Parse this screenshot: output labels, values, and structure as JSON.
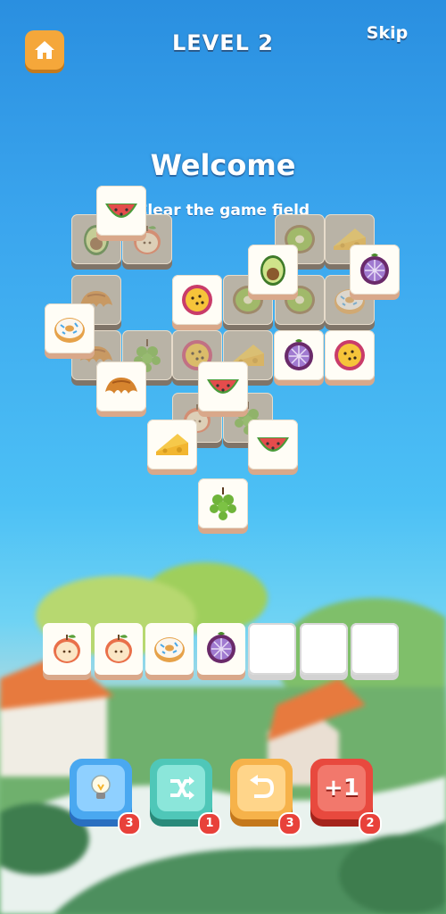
{
  "header": {
    "level_title": "LEVEL 2",
    "skip_label": "Skip",
    "home_icon": "home-icon"
  },
  "intro": {
    "title": "Welcome",
    "subtitle": "Clear the game field"
  },
  "colors": {
    "home_button": "#f5a73a",
    "hint_button": "#4aa8f0",
    "shuffle_button": "#4fc7b8",
    "undo_button": "#f6b24a",
    "extra_slot_button": "#e8493e",
    "badge": "#e8413a"
  },
  "board_tiles": [
    {
      "item": "kiwi",
      "state": "covered"
    },
    {
      "item": "cheese",
      "state": "covered"
    },
    {
      "item": "avocado",
      "state": "covered"
    },
    {
      "item": "apple",
      "state": "covered"
    },
    {
      "item": "croissant",
      "state": "covered"
    },
    {
      "item": "kiwi",
      "state": "covered"
    },
    {
      "item": "kiwi",
      "state": "covered"
    },
    {
      "item": "donut",
      "state": "covered"
    },
    {
      "item": "grapes",
      "state": "covered"
    },
    {
      "item": "passion-fruit",
      "state": "covered"
    },
    {
      "item": "cheese",
      "state": "covered"
    },
    {
      "item": "croissant",
      "state": "covered"
    },
    {
      "item": "grapes",
      "state": "covered"
    },
    {
      "item": "apple",
      "state": "covered"
    },
    {
      "item": "watermelon",
      "state": "free"
    },
    {
      "item": "passion-fruit",
      "state": "free"
    },
    {
      "item": "avocado",
      "state": "free"
    },
    {
      "item": "mangosteen",
      "state": "free"
    },
    {
      "item": "donut",
      "state": "free"
    },
    {
      "item": "mangosteen",
      "state": "free"
    },
    {
      "item": "passion-fruit",
      "state": "free"
    },
    {
      "item": "croissant",
      "state": "free"
    },
    {
      "item": "watermelon",
      "state": "free"
    },
    {
      "item": "cheese",
      "state": "free"
    },
    {
      "item": "watermelon",
      "state": "free"
    },
    {
      "item": "grapes",
      "state": "free"
    }
  ],
  "tray": {
    "capacity": 7,
    "slots": [
      "apple",
      "apple",
      "donut",
      "mangosteen",
      "",
      "",
      ""
    ]
  },
  "tools": [
    {
      "name": "hint",
      "icon": "lightbulb-icon",
      "count": "3"
    },
    {
      "name": "shuffle",
      "icon": "shuffle-icon",
      "count": "1"
    },
    {
      "name": "undo",
      "icon": "undo-icon",
      "count": "3"
    },
    {
      "name": "extra-slot",
      "label": "+1",
      "count": "2"
    }
  ]
}
